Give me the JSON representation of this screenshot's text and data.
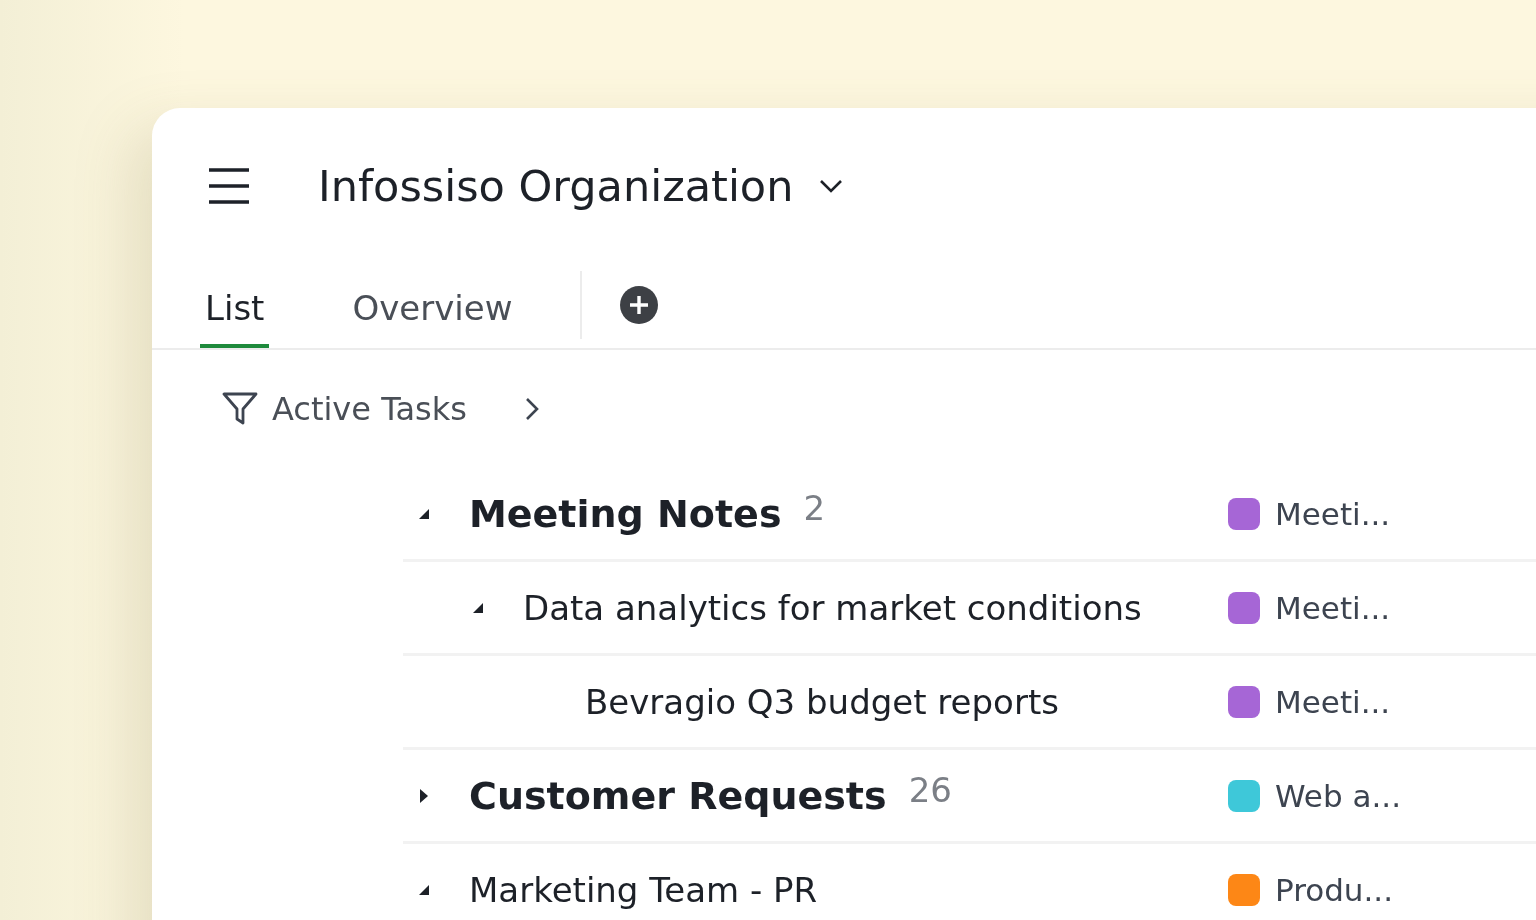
{
  "header": {
    "title": "Infossiso Organization"
  },
  "tabs": [
    {
      "label": "List",
      "selected": true
    },
    {
      "label": "Overview",
      "selected": false
    }
  ],
  "filter": {
    "label": "Active Tasks"
  },
  "rows": [
    {
      "kind": "group",
      "title": "Meeting Notes",
      "count": "2",
      "expanded": true,
      "tag": {
        "label": "Meeti...",
        "color": "#a666d6"
      },
      "children": [
        {
          "kind": "task",
          "title": "Data analytics for market conditions",
          "expanded": true,
          "tag": {
            "label": "Meeti...",
            "color": "#a666d6"
          },
          "children": [
            {
              "kind": "task",
              "title": "Bevragio Q3 budget reports",
              "tag": {
                "label": "Meeti...",
                "color": "#a666d6"
              }
            }
          ]
        }
      ]
    },
    {
      "kind": "group",
      "title": "Customer Requests",
      "count": "26",
      "expanded": false,
      "tag": {
        "label": "Web a...",
        "color": "#3ec8d9"
      }
    },
    {
      "kind": "task",
      "title": "Marketing Team - PR",
      "expanded": true,
      "tag": {
        "label": "Produ...",
        "color": "#fd8716"
      }
    }
  ]
}
